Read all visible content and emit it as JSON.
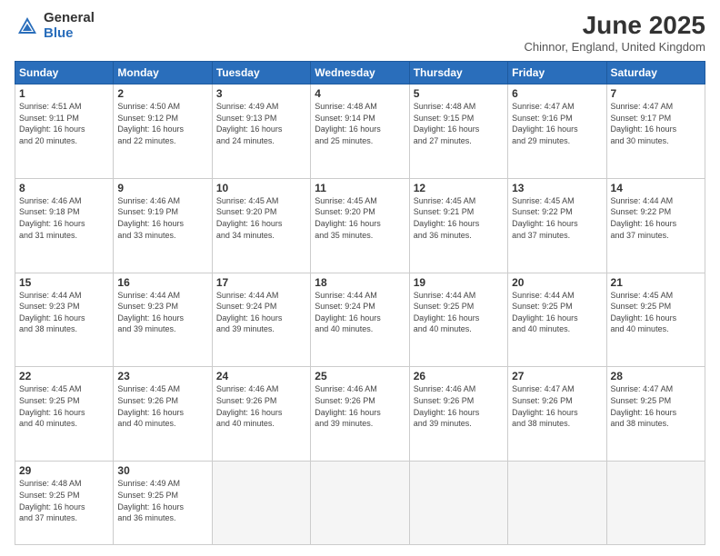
{
  "logo": {
    "general": "General",
    "blue": "Blue"
  },
  "header": {
    "month": "June 2025",
    "location": "Chinnor, England, United Kingdom"
  },
  "days_of_week": [
    "Sunday",
    "Monday",
    "Tuesday",
    "Wednesday",
    "Thursday",
    "Friday",
    "Saturday"
  ],
  "weeks": [
    [
      {
        "day": "1",
        "info": "Sunrise: 4:51 AM\nSunset: 9:11 PM\nDaylight: 16 hours\nand 20 minutes."
      },
      {
        "day": "2",
        "info": "Sunrise: 4:50 AM\nSunset: 9:12 PM\nDaylight: 16 hours\nand 22 minutes."
      },
      {
        "day": "3",
        "info": "Sunrise: 4:49 AM\nSunset: 9:13 PM\nDaylight: 16 hours\nand 24 minutes."
      },
      {
        "day": "4",
        "info": "Sunrise: 4:48 AM\nSunset: 9:14 PM\nDaylight: 16 hours\nand 25 minutes."
      },
      {
        "day": "5",
        "info": "Sunrise: 4:48 AM\nSunset: 9:15 PM\nDaylight: 16 hours\nand 27 minutes."
      },
      {
        "day": "6",
        "info": "Sunrise: 4:47 AM\nSunset: 9:16 PM\nDaylight: 16 hours\nand 29 minutes."
      },
      {
        "day": "7",
        "info": "Sunrise: 4:47 AM\nSunset: 9:17 PM\nDaylight: 16 hours\nand 30 minutes."
      }
    ],
    [
      {
        "day": "8",
        "info": "Sunrise: 4:46 AM\nSunset: 9:18 PM\nDaylight: 16 hours\nand 31 minutes."
      },
      {
        "day": "9",
        "info": "Sunrise: 4:46 AM\nSunset: 9:19 PM\nDaylight: 16 hours\nand 33 minutes."
      },
      {
        "day": "10",
        "info": "Sunrise: 4:45 AM\nSunset: 9:20 PM\nDaylight: 16 hours\nand 34 minutes."
      },
      {
        "day": "11",
        "info": "Sunrise: 4:45 AM\nSunset: 9:20 PM\nDaylight: 16 hours\nand 35 minutes."
      },
      {
        "day": "12",
        "info": "Sunrise: 4:45 AM\nSunset: 9:21 PM\nDaylight: 16 hours\nand 36 minutes."
      },
      {
        "day": "13",
        "info": "Sunrise: 4:45 AM\nSunset: 9:22 PM\nDaylight: 16 hours\nand 37 minutes."
      },
      {
        "day": "14",
        "info": "Sunrise: 4:44 AM\nSunset: 9:22 PM\nDaylight: 16 hours\nand 37 minutes."
      }
    ],
    [
      {
        "day": "15",
        "info": "Sunrise: 4:44 AM\nSunset: 9:23 PM\nDaylight: 16 hours\nand 38 minutes."
      },
      {
        "day": "16",
        "info": "Sunrise: 4:44 AM\nSunset: 9:23 PM\nDaylight: 16 hours\nand 39 minutes."
      },
      {
        "day": "17",
        "info": "Sunrise: 4:44 AM\nSunset: 9:24 PM\nDaylight: 16 hours\nand 39 minutes."
      },
      {
        "day": "18",
        "info": "Sunrise: 4:44 AM\nSunset: 9:24 PM\nDaylight: 16 hours\nand 40 minutes."
      },
      {
        "day": "19",
        "info": "Sunrise: 4:44 AM\nSunset: 9:25 PM\nDaylight: 16 hours\nand 40 minutes."
      },
      {
        "day": "20",
        "info": "Sunrise: 4:44 AM\nSunset: 9:25 PM\nDaylight: 16 hours\nand 40 minutes."
      },
      {
        "day": "21",
        "info": "Sunrise: 4:45 AM\nSunset: 9:25 PM\nDaylight: 16 hours\nand 40 minutes."
      }
    ],
    [
      {
        "day": "22",
        "info": "Sunrise: 4:45 AM\nSunset: 9:25 PM\nDaylight: 16 hours\nand 40 minutes."
      },
      {
        "day": "23",
        "info": "Sunrise: 4:45 AM\nSunset: 9:26 PM\nDaylight: 16 hours\nand 40 minutes."
      },
      {
        "day": "24",
        "info": "Sunrise: 4:46 AM\nSunset: 9:26 PM\nDaylight: 16 hours\nand 40 minutes."
      },
      {
        "day": "25",
        "info": "Sunrise: 4:46 AM\nSunset: 9:26 PM\nDaylight: 16 hours\nand 39 minutes."
      },
      {
        "day": "26",
        "info": "Sunrise: 4:46 AM\nSunset: 9:26 PM\nDaylight: 16 hours\nand 39 minutes."
      },
      {
        "day": "27",
        "info": "Sunrise: 4:47 AM\nSunset: 9:26 PM\nDaylight: 16 hours\nand 38 minutes."
      },
      {
        "day": "28",
        "info": "Sunrise: 4:47 AM\nSunset: 9:25 PM\nDaylight: 16 hours\nand 38 minutes."
      }
    ],
    [
      {
        "day": "29",
        "info": "Sunrise: 4:48 AM\nSunset: 9:25 PM\nDaylight: 16 hours\nand 37 minutes."
      },
      {
        "day": "30",
        "info": "Sunrise: 4:49 AM\nSunset: 9:25 PM\nDaylight: 16 hours\nand 36 minutes."
      },
      {
        "day": "",
        "info": ""
      },
      {
        "day": "",
        "info": ""
      },
      {
        "day": "",
        "info": ""
      },
      {
        "day": "",
        "info": ""
      },
      {
        "day": "",
        "info": ""
      }
    ]
  ]
}
